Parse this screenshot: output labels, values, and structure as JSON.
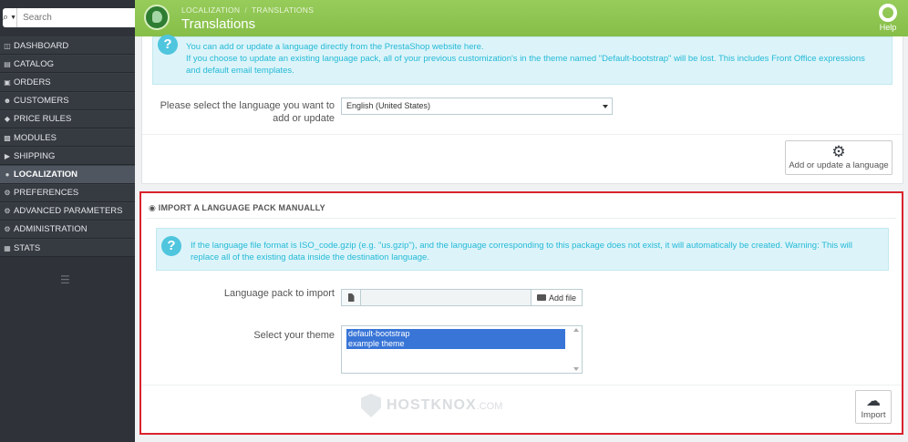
{
  "sidebar": {
    "search_placeholder": "Search",
    "items": [
      {
        "label": "DASHBOARD",
        "icon": "dashboard-icon"
      },
      {
        "label": "CATALOG",
        "icon": "catalog-icon"
      },
      {
        "label": "ORDERS",
        "icon": "orders-icon"
      },
      {
        "label": "CUSTOMERS",
        "icon": "customers-icon"
      },
      {
        "label": "PRICE RULES",
        "icon": "price-rules-icon"
      },
      {
        "label": "MODULES",
        "icon": "modules-icon"
      },
      {
        "label": "SHIPPING",
        "icon": "shipping-icon"
      },
      {
        "label": "LOCALIZATION",
        "icon": "globe-icon",
        "active": true
      },
      {
        "label": "PREFERENCES",
        "icon": "wrench-icon"
      },
      {
        "label": "ADVANCED PARAMETERS",
        "icon": "cogs-icon"
      },
      {
        "label": "ADMINISTRATION",
        "icon": "cog-icon"
      },
      {
        "label": "STATS",
        "icon": "stats-icon"
      }
    ]
  },
  "header": {
    "breadcrumb_1": "LOCALIZATION",
    "breadcrumb_sep": "/",
    "breadcrumb_2": "TRANSLATIONS",
    "title": "Translations",
    "help_label": "Help"
  },
  "add_update": {
    "alert_line1": "You can add or update a language directly from the PrestaShop website here.",
    "alert_line2": "If you choose to update an existing language pack, all of your previous customization's in the theme named \"Default-bootstrap\" will be lost. This includes Front Office expressions and default email templates.",
    "select_label": "Please select the language you want to add or update",
    "selected_language": "English (United States)",
    "button_label": "Add or update a language"
  },
  "import": {
    "heading": "IMPORT A LANGUAGE PACK MANUALLY",
    "alert_text": "If the language file format is ISO_code.gzip (e.g. \"us.gzip\"), and the language corresponding to this package does not exist, it will automatically be created. Warning: This will replace all of the existing data inside the destination language.",
    "file_label": "Language pack to import",
    "add_file_label": "Add file",
    "theme_label": "Select your theme",
    "themes": [
      "default-bootstrap",
      "example theme"
    ],
    "import_button_label": "Import"
  },
  "watermark": {
    "text": "HOSTKNOX",
    "suffix": ".COM"
  },
  "colors": {
    "header_green": "#8bc34a",
    "sidebar_bg": "#363a41",
    "alert_text": "#25b9d7",
    "highlight_border": "#d9232d",
    "selected_option": "#3875d7"
  }
}
